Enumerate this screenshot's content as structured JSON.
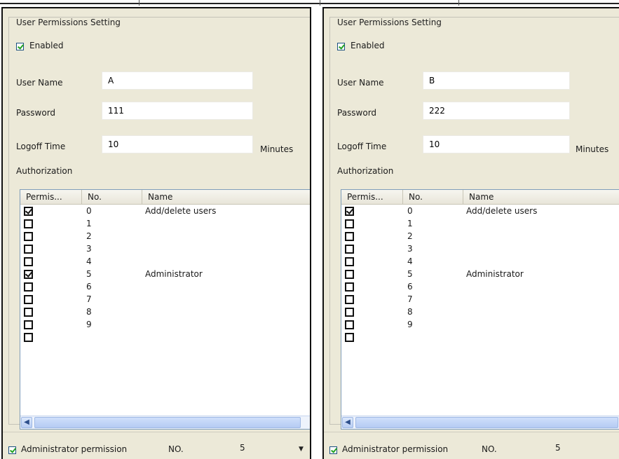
{
  "panels": [
    {
      "group_title": "User Permissions Setting",
      "enabled_label": "Enabled",
      "user_name_label": "User Name",
      "user_name_value": "A",
      "password_label": "Password",
      "password_value": "111",
      "logoff_label": "Logoff Time",
      "logoff_value": "10",
      "logoff_unit": "Minutes",
      "authorization_label": "Authorization",
      "columns": [
        "Permis...",
        "No.",
        "Name"
      ],
      "rows": [
        {
          "checked": true,
          "no": "0",
          "name": "Add/delete users"
        },
        {
          "checked": false,
          "no": "1",
          "name": ""
        },
        {
          "checked": false,
          "no": "2",
          "name": ""
        },
        {
          "checked": false,
          "no": "3",
          "name": ""
        },
        {
          "checked": false,
          "no": "4",
          "name": ""
        },
        {
          "checked": true,
          "no": "5",
          "name": "Administrator"
        },
        {
          "checked": false,
          "no": "6",
          "name": ""
        },
        {
          "checked": false,
          "no": "7",
          "name": ""
        },
        {
          "checked": false,
          "no": "8",
          "name": ""
        },
        {
          "checked": false,
          "no": "9",
          "name": ""
        }
      ],
      "admin_label": "Administrator permission",
      "no_label": "NO.",
      "no_value": "5"
    },
    {
      "group_title": "User Permissions Setting",
      "enabled_label": "Enabled",
      "user_name_label": "User Name",
      "user_name_value": "B",
      "password_label": "Password",
      "password_value": "222",
      "logoff_label": "Logoff Time",
      "logoff_value": "10",
      "logoff_unit": "Minutes",
      "authorization_label": "Authorization",
      "columns": [
        "Permis...",
        "No.",
        "Name"
      ],
      "rows": [
        {
          "checked": true,
          "no": "0",
          "name": "Add/delete users"
        },
        {
          "checked": false,
          "no": "1",
          "name": ""
        },
        {
          "checked": false,
          "no": "2",
          "name": ""
        },
        {
          "checked": false,
          "no": "3",
          "name": ""
        },
        {
          "checked": false,
          "no": "4",
          "name": ""
        },
        {
          "checked": false,
          "no": "5",
          "name": "Administrator"
        },
        {
          "checked": false,
          "no": "6",
          "name": ""
        },
        {
          "checked": false,
          "no": "7",
          "name": ""
        },
        {
          "checked": false,
          "no": "8",
          "name": ""
        },
        {
          "checked": false,
          "no": "9",
          "name": ""
        }
      ],
      "admin_label": "Administrator permission",
      "no_label": "NO.",
      "no_value": "5"
    }
  ],
  "icons": {
    "scroll_left": "◀",
    "scroll_right": "▶",
    "dropdown": "▼"
  }
}
